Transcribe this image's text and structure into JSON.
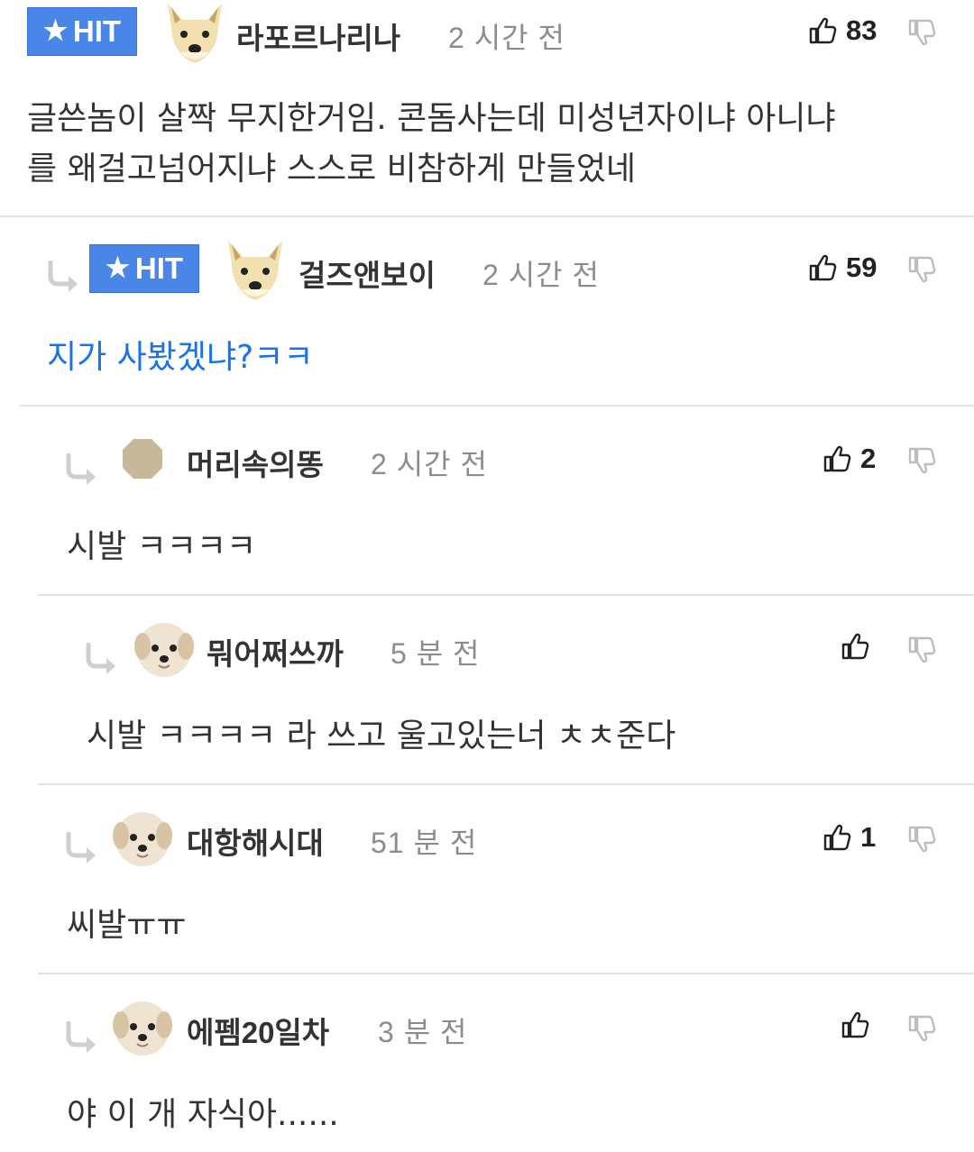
{
  "hit_label": "HIT",
  "colors": {
    "hit_badge": "#4a86e8",
    "link_text": "#1a73e8",
    "divider": "#e2e2e2"
  },
  "comments": [
    {
      "hit": true,
      "reply": false,
      "nickname": "라포르나리나",
      "time": "2 시간 전",
      "likes": "83",
      "avatar": "fox-avatar-icon",
      "text_lines": [
        "글쓴놈이 살짝 무지한거임. 콘돔사는데 미성년자이냐 아니냐",
        "를 왜걸고넘어지냐 스스로 비참하게 만들었네"
      ]
    },
    {
      "hit": true,
      "reply": true,
      "nickname": "걸즈앤보이",
      "time": "2 시간 전",
      "likes": "59",
      "avatar": "fox-avatar-icon",
      "text_lines": [
        "지가 사봤겠냐?ㅋㅋ"
      ]
    },
    {
      "hit": false,
      "reply": true,
      "nickname": "머리속의똥",
      "time": "2 시간 전",
      "likes": "2",
      "avatar": "default-avatar-icon",
      "text_lines": [
        "시발 ㅋㅋㅋㅋ"
      ]
    },
    {
      "hit": false,
      "reply": true,
      "nickname": "뭐어쩌쓰까",
      "time": "5 분 전",
      "likes": "",
      "avatar": "puppy-avatar-icon",
      "text_lines": [
        "시발 ㅋㅋㅋㅋ 라 쓰고 울고있는너 ㅊㅊ준다"
      ]
    },
    {
      "hit": false,
      "reply": true,
      "nickname": "대항해시대",
      "time": "51 분 전",
      "likes": "1",
      "avatar": "puppy-avatar-icon",
      "text_lines": [
        "씨발ㅠㅠ"
      ]
    },
    {
      "hit": false,
      "reply": true,
      "nickname": "에펨20일차",
      "time": "3 분 전",
      "likes": "",
      "avatar": "puppy-avatar-icon",
      "text_lines": [
        "야 이 개 자식아......"
      ]
    }
  ]
}
